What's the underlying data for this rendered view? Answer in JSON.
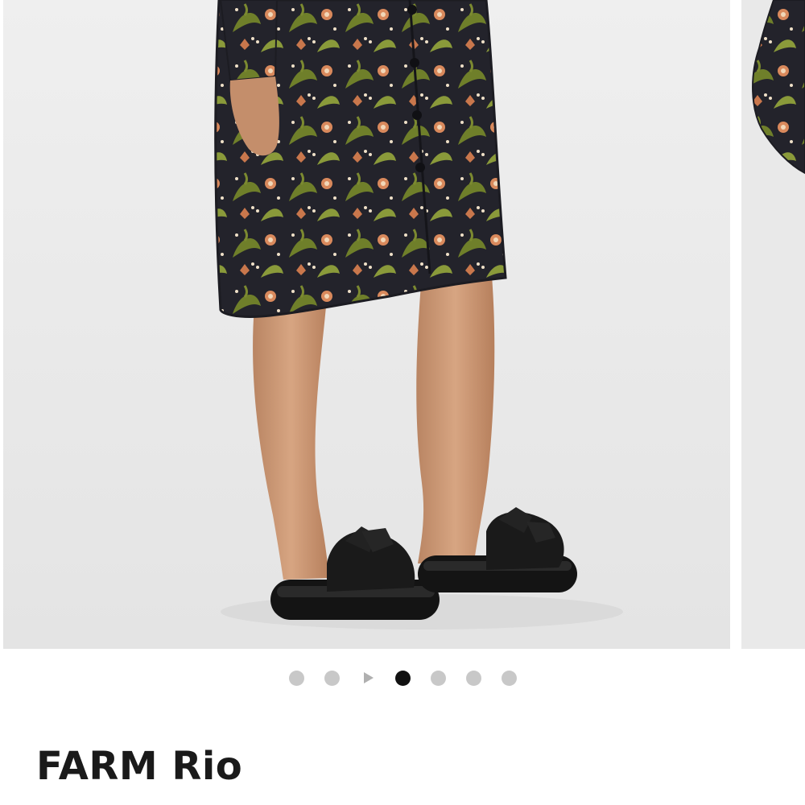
{
  "carousel": {
    "slide_count": 7,
    "active_index": 3,
    "has_play_control": true,
    "colors": {
      "active_dot": "#111111",
      "inactive_dot": "#c8c8c8",
      "play_icon": "#b0b0b0",
      "photo_background": "#ebebeb"
    },
    "controls": [
      {
        "kind": "dot",
        "name": "carousel-dot-1"
      },
      {
        "kind": "dot",
        "name": "carousel-dot-2"
      },
      {
        "kind": "play",
        "name": "play-icon"
      },
      {
        "kind": "dot",
        "name": "carousel-dot-3",
        "active": true
      },
      {
        "kind": "dot",
        "name": "carousel-dot-4"
      },
      {
        "kind": "dot",
        "name": "carousel-dot-5"
      },
      {
        "kind": "dot",
        "name": "carousel-dot-6"
      }
    ]
  },
  "product": {
    "brand": "FARM Rio"
  }
}
